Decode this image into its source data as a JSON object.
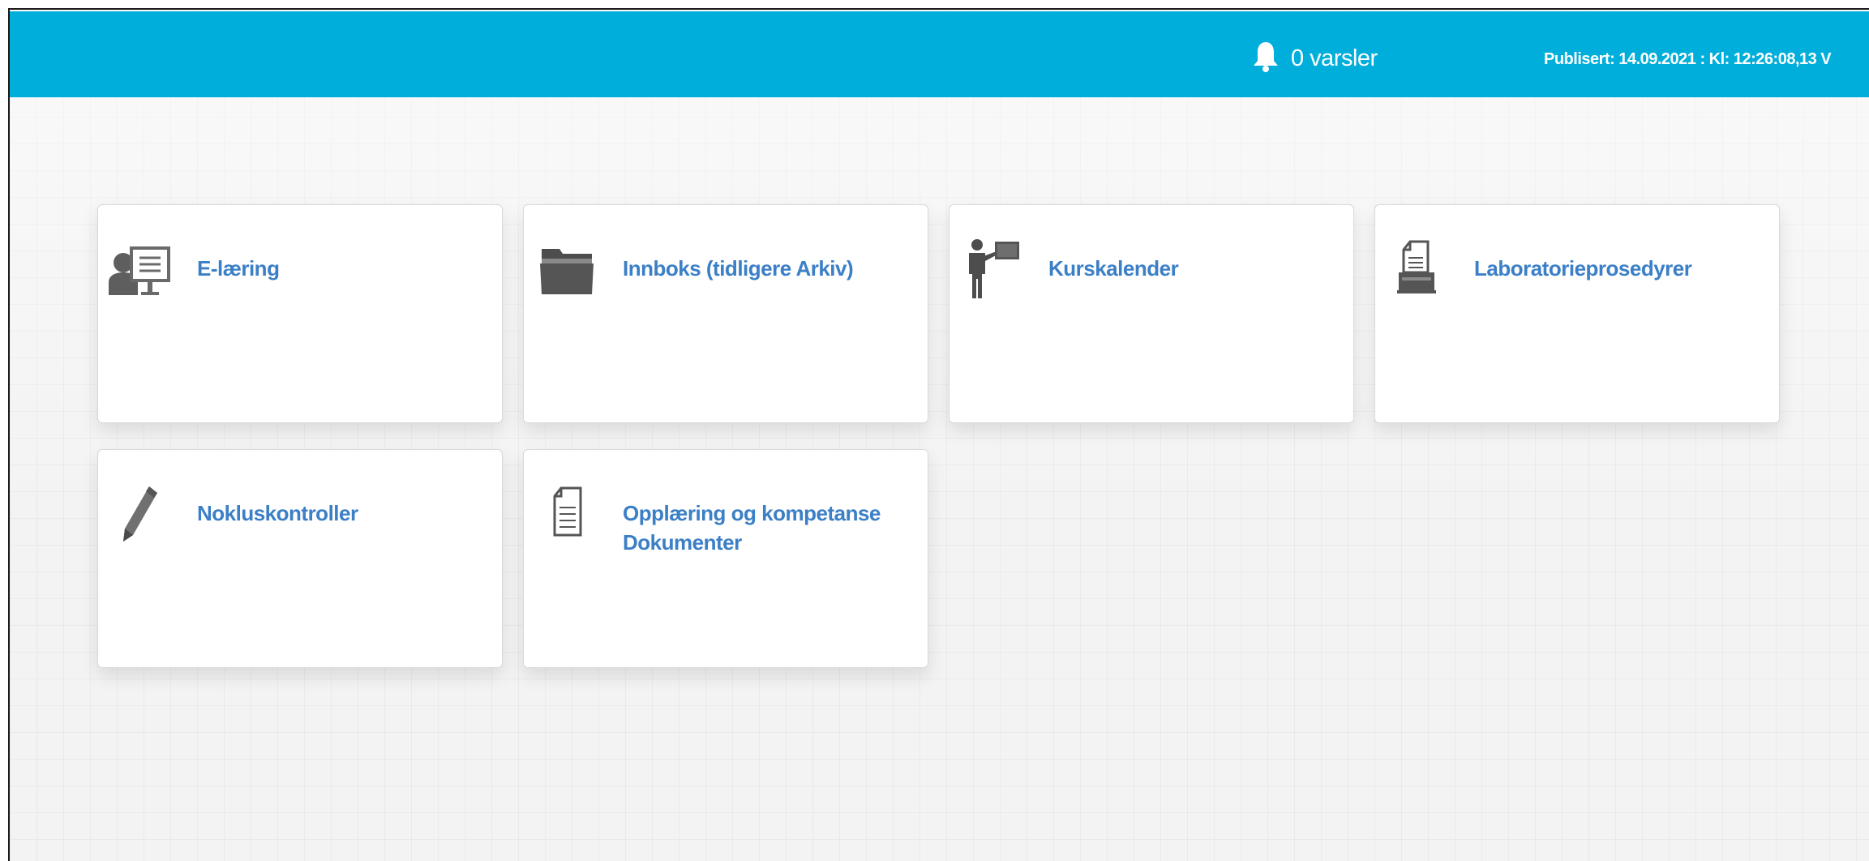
{
  "header": {
    "notifications_icon": "bell-icon",
    "notifications_label": "0 varsler",
    "published_text": "Publisert: 14.09.2021 : Kl: 12:26:08,13 V"
  },
  "tiles": [
    {
      "label": "E-læring",
      "icon": "e-learning-icon"
    },
    {
      "label": "Innboks (tidligere Arkiv)",
      "icon": "folder-icon"
    },
    {
      "label": "Kurskalender",
      "icon": "presenter-icon"
    },
    {
      "label": "Laboratorieprosedyrer",
      "icon": "document-printer-icon"
    },
    {
      "label": "Nokluskontroller",
      "icon": "pencil-icon"
    },
    {
      "label": "Opplæring og kompetanse Dokumenter",
      "icon": "document-icon"
    }
  ],
  "colors": {
    "header_bg": "#00aedb",
    "link_text": "#3b7fc6",
    "icon_gray": "#666666"
  }
}
